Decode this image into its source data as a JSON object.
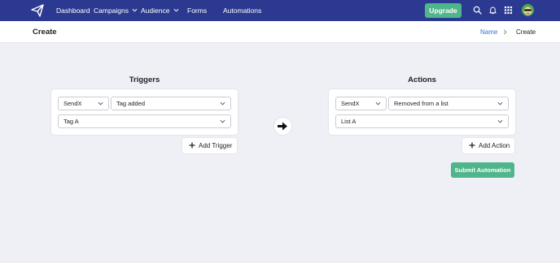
{
  "nav": {
    "items": [
      {
        "label": "Dashboard"
      },
      {
        "label": "Campaigns"
      },
      {
        "label": "Audience"
      },
      {
        "label": "Forms"
      },
      {
        "label": "Automations"
      }
    ],
    "upgrade_label": "Upgrade",
    "icons": [
      "logo-icon",
      "search-icon",
      "bell-icon",
      "apps-grid-icon",
      "avatar"
    ],
    "colors": {
      "nav_bg": "#2b3990",
      "accent_green": "#4fb58a",
      "link_blue": "#3a6fd8"
    }
  },
  "header": {
    "title": "Create",
    "breadcrumb": {
      "link": "Name",
      "current": "Create"
    }
  },
  "triggers": {
    "title": "Triggers",
    "app_select": "SendX",
    "event_select": "Tag added",
    "value_select": "Tag A",
    "add_label": "Add Trigger"
  },
  "actions": {
    "title": "Actions",
    "app_select": "SendX",
    "event_select": "Removed from a list",
    "value_select": "List A",
    "add_label": "Add Action",
    "submit_label": "Submit Automation"
  }
}
